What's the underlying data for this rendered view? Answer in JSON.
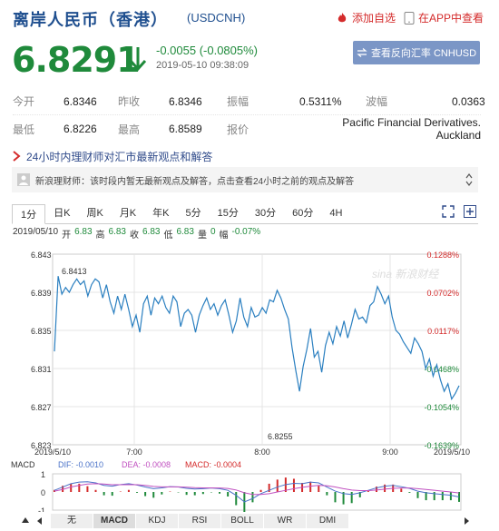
{
  "header": {
    "title": "离岸人民币（香港）",
    "code": "(USDCNH)",
    "add_watch": "添加自选",
    "open_app": "在APP中查看",
    "price": "6.8291",
    "change": "-0.0055 (-0.0805%)",
    "datetime": "2019-05-10 09:38:09",
    "reverse_button": "查看反向汇率 CNHUSD",
    "colors": {
      "down": "#1f8a3b",
      "up": "#d42b2b",
      "title": "#1f4f8f"
    }
  },
  "stats": {
    "open_label": "今开",
    "open": "6.8346",
    "prev_label": "昨收",
    "prev": "6.8346",
    "amp_label": "振幅",
    "amp": "0.5311%",
    "wave_label": "波幅",
    "wave": "0.0363",
    "low_label": "最低",
    "low": "6.8226",
    "high_label": "最高",
    "high": "6.8589",
    "quote_label": "报价",
    "quote": "Pacific Financial Derivatives. Auckland"
  },
  "news": {
    "headline": "24小时内理财师对汇市最新观点和解答",
    "body": "新浪理财师：该时段内暂无最新观点及解答，点击查看24小时之前的观点及解答"
  },
  "tabs": [
    "1分",
    "日K",
    "周K",
    "月K",
    "年K",
    "5分",
    "15分",
    "30分",
    "60分",
    "4H"
  ],
  "info": {
    "date": "2019/05/10",
    "open_l": "开",
    "open": "6.83",
    "high_l": "高",
    "high": "6.83",
    "close_l": "收",
    "close": "6.83",
    "low_l": "低",
    "low": "6.83",
    "vol_l": "量",
    "vol": "0",
    "amp_l": "幅",
    "amp": "-0.07%"
  },
  "watermark": "sina 新浪财经",
  "chart_data": {
    "type": "line",
    "y_left_ticks": [
      "6.843",
      "6.839",
      "6.835",
      "6.831",
      "6.827",
      "6.823"
    ],
    "y_right_ticks": [
      "0.1288%",
      "0.0702%",
      "0.0117%",
      "-0.0468%",
      "-0.1054%",
      "-0.1639%"
    ],
    "x_ticks": [
      "2019/5/10",
      "7:00",
      "8:00",
      "9:00",
      "2019/5/10"
    ],
    "ylim": [
      6.823,
      6.843
    ],
    "annotations": [
      {
        "text": "6.8413",
        "value": 6.8413
      },
      {
        "text": "6.8255",
        "value": 6.8255
      }
    ],
    "series": [
      {
        "values": [
          6.8328,
          6.8407,
          6.8388,
          6.8395,
          6.839,
          6.8398,
          6.8404,
          6.8398,
          6.8402,
          6.8386,
          6.8398,
          6.8404,
          6.8401,
          6.8384,
          6.8398,
          6.838,
          6.8368,
          6.8386,
          6.8372,
          6.8388,
          6.8372,
          6.8354,
          6.8366,
          6.8348,
          6.8378,
          6.8386,
          6.8366,
          6.8384,
          6.8378,
          6.8386,
          6.8374,
          6.8368,
          6.8386,
          6.838,
          6.8354,
          6.8368,
          6.8372,
          6.8366,
          6.8348,
          6.8366,
          6.8376,
          6.8384,
          6.8372,
          6.8378,
          6.8366,
          6.8376,
          6.8382,
          6.8366,
          6.8348,
          6.836,
          6.8384,
          6.8364,
          6.8354,
          6.8374,
          6.8364,
          6.8366,
          6.8374,
          6.8368,
          6.8382,
          6.838,
          6.8392,
          6.8384,
          6.8372,
          6.8362,
          6.8332,
          6.8308,
          6.8286,
          6.8312,
          6.833,
          6.8352,
          6.8322,
          6.8328,
          6.8306,
          6.8334,
          6.8348,
          6.8336,
          6.8354,
          6.8344,
          6.836,
          6.8342,
          6.8356,
          6.8372,
          6.8362,
          6.8364,
          6.8358,
          6.8376,
          6.838,
          6.8396,
          6.8388,
          6.8378,
          6.8386,
          6.8364,
          6.835,
          6.8346,
          6.8338,
          6.8332,
          6.8326,
          6.8342,
          6.8336,
          6.8328,
          6.831,
          6.832,
          6.8302,
          6.8314,
          6.8298,
          6.8286,
          6.8294,
          6.8278,
          6.8284,
          6.8292
        ]
      }
    ]
  },
  "macd": {
    "label": "MACD",
    "dif": "DIF: -0.0010",
    "dea": "DEA: -0.0008",
    "macd": "MACD: -0.0004",
    "y_ticks": [
      "1",
      "0",
      "-1"
    ],
    "dif_values": [
      0.1,
      0.3,
      0.5,
      0.6,
      0.62,
      0.55,
      0.4,
      0.35,
      0.45,
      0.5,
      0.42,
      0.3,
      0.2,
      0.25,
      0.32,
      0.3,
      0.22,
      0.18,
      0.2,
      0.24,
      0.2,
      0.1,
      -0.2,
      -0.6,
      -0.4,
      -0.1,
      0.1,
      0.3,
      0.45,
      0.52,
      0.5,
      0.6,
      0.55,
      0.3,
      0.05,
      -0.1,
      -0.15,
      -0.05,
      0.1,
      0.25,
      0.35,
      0.4,
      0.32,
      0.22,
      0.05,
      -0.05,
      -0.1,
      -0.15,
      -0.2,
      -0.3
    ],
    "dea_values": [
      0.05,
      0.15,
      0.3,
      0.4,
      0.48,
      0.5,
      0.48,
      0.44,
      0.44,
      0.45,
      0.44,
      0.4,
      0.34,
      0.31,
      0.31,
      0.31,
      0.29,
      0.26,
      0.25,
      0.25,
      0.24,
      0.21,
      0.12,
      -0.05,
      -0.15,
      -0.15,
      -0.1,
      0.0,
      0.1,
      0.2,
      0.28,
      0.35,
      0.4,
      0.38,
      0.3,
      0.2,
      0.12,
      0.08,
      0.08,
      0.12,
      0.17,
      0.22,
      0.24,
      0.24,
      0.2,
      0.15,
      0.1,
      0.05,
      0.0,
      -0.06
    ],
    "bottom_tabs": [
      "无",
      "MACD",
      "KDJ",
      "RSI",
      "BOLL",
      "WR",
      "DMI"
    ]
  }
}
